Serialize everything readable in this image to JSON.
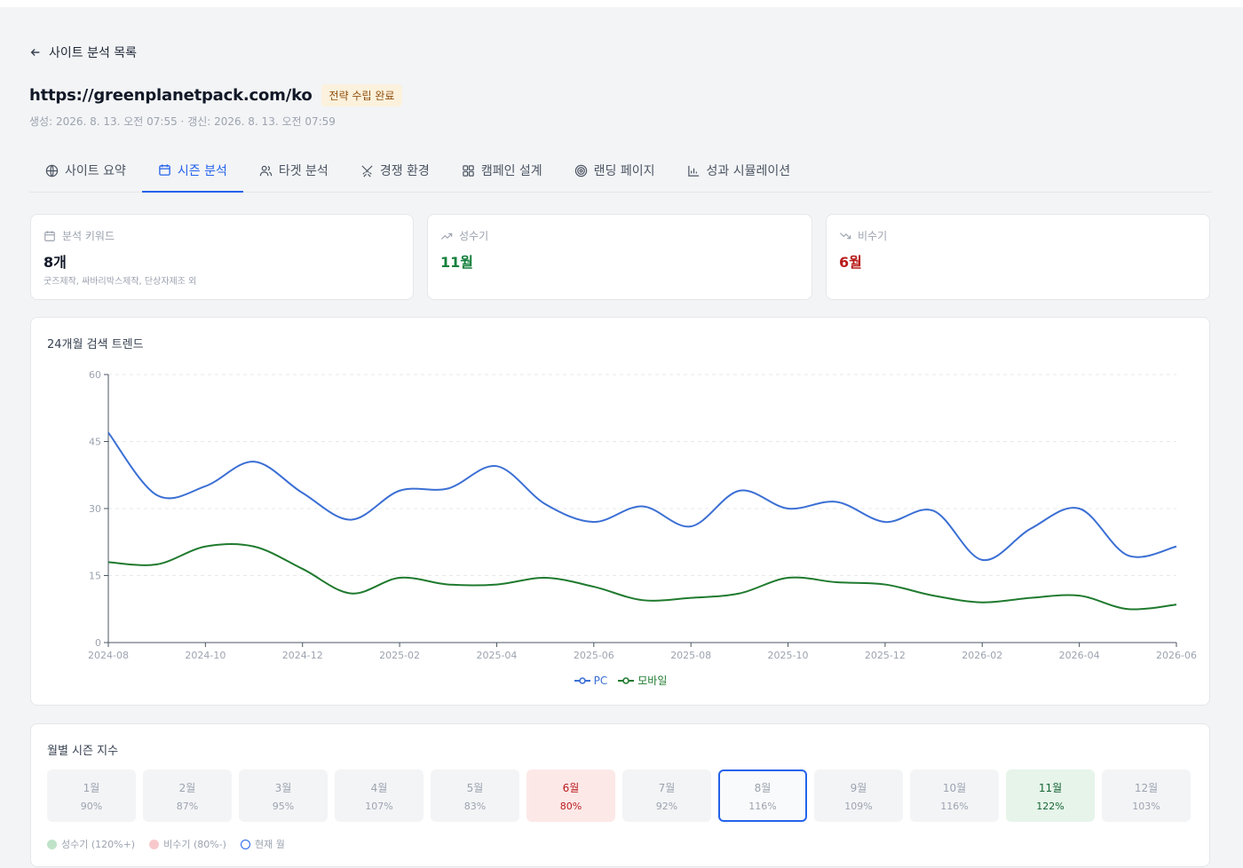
{
  "nav": {
    "back_label": "사이트 분석 목록"
  },
  "site": {
    "url": "https://greenplanetpack.com/ko",
    "status": "전략 수립 완료",
    "meta": "생성: 2026. 8. 13. 오전 07:55 · 갱신: 2026. 8. 13. 오전 07:59"
  },
  "tabs": [
    {
      "label": "사이트 요약",
      "icon": "globe-icon"
    },
    {
      "label": "시즌 분석",
      "icon": "calendar-icon",
      "active": true
    },
    {
      "label": "타겟 분석",
      "icon": "users-icon"
    },
    {
      "label": "경쟁 환경",
      "icon": "swords-icon"
    },
    {
      "label": "캠페인 설계",
      "icon": "grid-icon"
    },
    {
      "label": "랜딩 페이지",
      "icon": "target-icon"
    },
    {
      "label": "성과 시뮬레이션",
      "icon": "bar-chart-icon"
    }
  ],
  "stats": {
    "keywords": {
      "label": "분석 키워드",
      "value": "8개",
      "sub": "굿즈제작, 싸바리박스제작, 단상자제조 외",
      "icon": "calendar-icon"
    },
    "peak": {
      "label": "성수기",
      "value": "11월",
      "icon": "trending-up-icon",
      "color": "#15803d"
    },
    "offpeak": {
      "label": "비수기",
      "value": "6월",
      "icon": "trending-down-icon",
      "color": "#b91c1c"
    }
  },
  "trend": {
    "title": "24개월 검색 트렌드"
  },
  "chart_data": {
    "type": "line",
    "x": [
      "2024-08",
      "2024-09",
      "2024-10",
      "2024-11",
      "2024-12",
      "2025-01",
      "2025-02",
      "2025-03",
      "2025-04",
      "2025-05",
      "2025-06",
      "2025-07",
      "2025-08",
      "2025-09",
      "2025-10",
      "2025-11",
      "2025-12",
      "2026-01",
      "2026-02",
      "2026-03",
      "2026-04",
      "2026-05",
      "2026-06"
    ],
    "x_tick_labels": [
      "2024-08",
      "2024-10",
      "2024-12",
      "2025-02",
      "2025-04",
      "2025-06",
      "2025-08",
      "2025-10",
      "2025-12",
      "2026-02",
      "2026-04",
      "2026-06"
    ],
    "y_ticks": [
      0,
      15,
      30,
      45,
      60
    ],
    "ylim": [
      0,
      60
    ],
    "grid": true,
    "legend": "bottom-center",
    "series": [
      {
        "name": "PC",
        "color": "#3b6fd4",
        "values": [
          47,
          33,
          35,
          40.5,
          33.5,
          27.5,
          34,
          34.5,
          39.5,
          31,
          27,
          30.5,
          26,
          34,
          30,
          31.5,
          27,
          29.5,
          18.5,
          25.5,
          30,
          19.5,
          21.5
        ]
      },
      {
        "name": "모바일",
        "color": "#1f7a2e",
        "values": [
          18,
          17.5,
          21.5,
          21.5,
          16.5,
          11,
          14.5,
          13,
          13,
          14.5,
          12.5,
          9.5,
          10,
          11,
          14.5,
          13.5,
          13,
          10.5,
          9,
          10,
          10.5,
          7.5,
          8.5
        ]
      }
    ]
  },
  "seasonal": {
    "title": "월별 시즌 지수",
    "months": [
      {
        "label": "1월",
        "value": "90%"
      },
      {
        "label": "2월",
        "value": "87%"
      },
      {
        "label": "3월",
        "value": "95%"
      },
      {
        "label": "4월",
        "value": "107%"
      },
      {
        "label": "5월",
        "value": "83%"
      },
      {
        "label": "6월",
        "value": "80%",
        "state": "low"
      },
      {
        "label": "7월",
        "value": "92%"
      },
      {
        "label": "8월",
        "value": "116%",
        "state": "current"
      },
      {
        "label": "9월",
        "value": "109%"
      },
      {
        "label": "10월",
        "value": "116%"
      },
      {
        "label": "11월",
        "value": "122%",
        "state": "high"
      },
      {
        "label": "12월",
        "value": "103%"
      }
    ],
    "legend": {
      "high": "성수기 (120%+)",
      "low": "비수기 (80%-)",
      "current": "현재 월"
    }
  }
}
